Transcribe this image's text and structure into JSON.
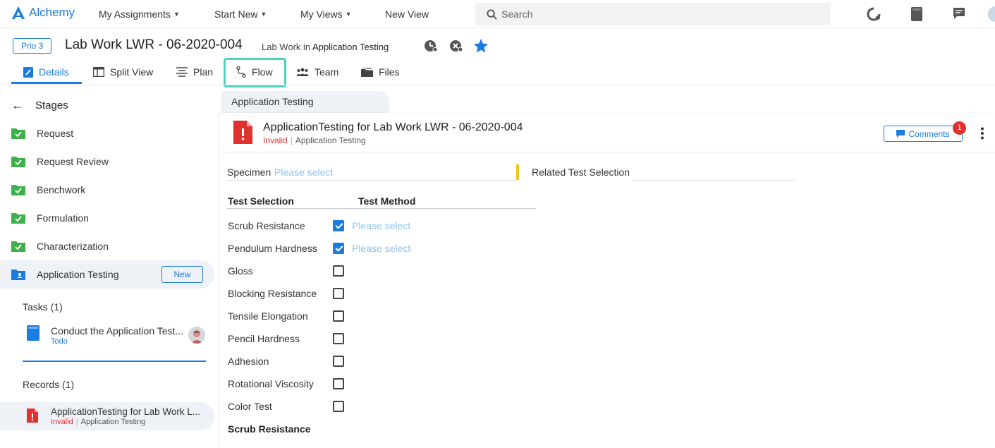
{
  "topnav": {
    "logo": "Alchemy",
    "items": [
      "My Assignments",
      "Start New",
      "My Views",
      "New View"
    ],
    "search_placeholder": "Search"
  },
  "header": {
    "prio": "Prio 3",
    "title": "Lab Work LWR - 06-2020-004",
    "subtitle_prefix": "Lab Work in",
    "subtitle_bold": "Application Testing"
  },
  "tabs": [
    {
      "label": "Details",
      "active": true
    },
    {
      "label": "Split View"
    },
    {
      "label": "Plan"
    },
    {
      "label": "Flow"
    },
    {
      "label": "Team"
    },
    {
      "label": "Files"
    }
  ],
  "sidebar": {
    "header": "Stages",
    "stages": [
      "Request",
      "Request Review",
      "Benchwork",
      "Formulation",
      "Characterization",
      "Application Testing"
    ],
    "new_button": "New",
    "tasks_label": "Tasks (1)",
    "task": {
      "title": "Conduct the Application Test...",
      "status": "Todo"
    },
    "records_label": "Records (1)",
    "record": {
      "title": "ApplicationTesting for Lab Work L...",
      "status": "Invalid",
      "stage": "Application Testing"
    }
  },
  "main": {
    "crumb": "Application Testing",
    "doc_title": "ApplicationTesting for Lab Work LWR - 06-2020-004",
    "doc_status": "Invalid",
    "doc_stage": "Application Testing",
    "comments_label": "Comments",
    "comments_count": "1",
    "specimen_label": "Specimen",
    "specimen_placeholder": "Please select",
    "related_label": "Related Test Selection",
    "col_test_selection": "Test Selection",
    "col_test_method": "Test Method",
    "tests": [
      {
        "name": "Scrub Resistance",
        "checked": true,
        "method": "Please select"
      },
      {
        "name": "Pendulum Hardness",
        "checked": true,
        "method": "Please select"
      },
      {
        "name": "Gloss",
        "checked": false
      },
      {
        "name": "Blocking Resistance",
        "checked": false
      },
      {
        "name": "Tensile Elongation",
        "checked": false
      },
      {
        "name": "Pencil Hardness",
        "checked": false
      },
      {
        "name": "Adhesion",
        "checked": false
      },
      {
        "name": "Rotational Viscosity",
        "checked": false
      },
      {
        "name": "Color Test",
        "checked": false
      }
    ],
    "section_heading": "Scrub Resistance"
  },
  "colors": {
    "accent": "#1a7be0",
    "success": "#3db24a",
    "danger": "#e03131",
    "highlight": "#4fd1c1"
  }
}
